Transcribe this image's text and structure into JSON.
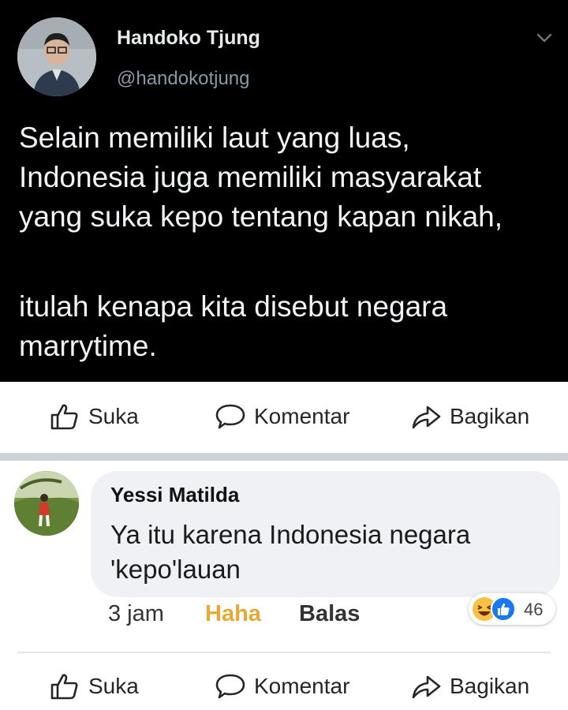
{
  "tweet": {
    "author_name": "Handoko Tjung",
    "author_handle": "@handokotjung",
    "paragraph1": [
      "Selain memiliki laut yang luas,",
      "Indonesia juga memiliki masyarakat",
      "yang suka kepo tentang kapan nikah,"
    ],
    "paragraph2": [
      "itulah kenapa kita disebut negara",
      "marrytime."
    ]
  },
  "post_actions": {
    "like_label": "Suka",
    "comment_label": "Komentar",
    "share_label": "Bagikan"
  },
  "comment": {
    "author_name": "Yessi Matilda",
    "text_lines": [
      "Ya itu karena Indonesia negara",
      "'kepo'lauan"
    ],
    "time": "3 jam",
    "reaction_label": "Haha",
    "reply_label": "Balas",
    "reaction_count": "46",
    "reaction_icons": [
      "haha-emoji-icon",
      "like-reaction-icon"
    ]
  },
  "comment_actions": {
    "like_label": "Suka",
    "comment_label": "Komentar",
    "share_label": "Bagikan"
  },
  "colors": {
    "tweet_background": "#000000",
    "haha_active": "#e8a932",
    "like_blue": "#1877f2",
    "bubble_background": "#eff1f4"
  }
}
